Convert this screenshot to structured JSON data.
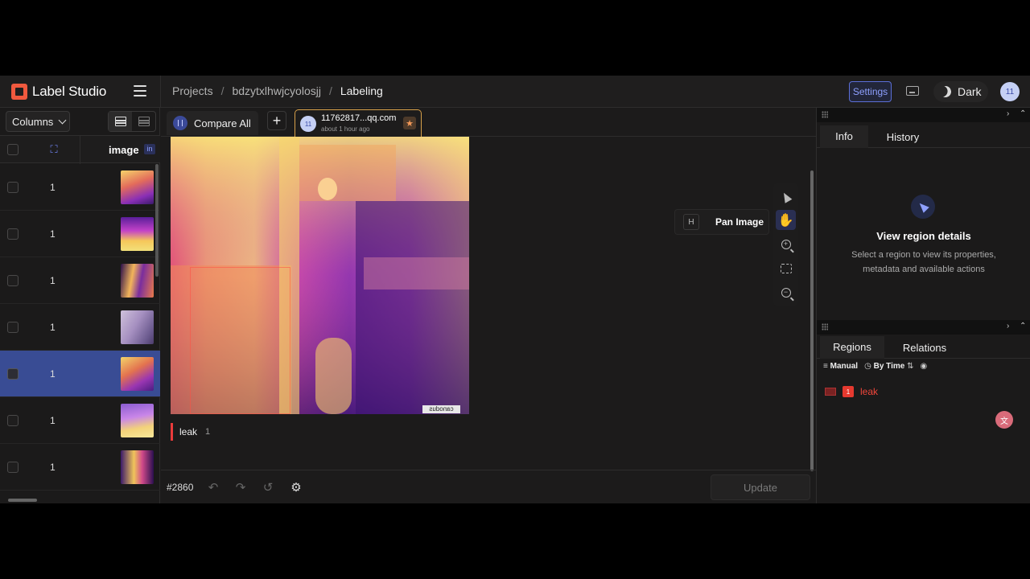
{
  "app": {
    "name": "Label Studio"
  },
  "breadcrumb": [
    "Projects",
    "bdzytxlhwjcyolosjj",
    "Labeling"
  ],
  "header": {
    "settings_label": "Settings",
    "theme_label": "Dark",
    "user_initials": "11"
  },
  "table": {
    "columns_label": "Columns",
    "image_header": "image",
    "badge": "in",
    "rows": [
      {
        "value": "1",
        "selected": false
      },
      {
        "value": "1",
        "selected": false
      },
      {
        "value": "1",
        "selected": false
      },
      {
        "value": "1",
        "selected": false
      },
      {
        "value": "1",
        "selected": true
      },
      {
        "value": "1",
        "selected": false
      },
      {
        "value": "1",
        "selected": false
      }
    ]
  },
  "tabs": {
    "compare_all": "Compare All",
    "annotation": {
      "avatar": "11",
      "title": "11762817...qq.com",
      "subtitle": "about 1 hour ago"
    }
  },
  "canvas": {
    "tooltip": {
      "key": "H",
      "label": "Pan Image"
    },
    "region_label": "leak",
    "region_count": "1"
  },
  "bottom": {
    "task_id": "#2860",
    "update_label": "Update"
  },
  "info_panel": {
    "tab_info": "Info",
    "tab_history": "History",
    "empty_title": "View region details",
    "empty_desc": "Select a region to view its properties, metadata and available actions"
  },
  "regions_panel": {
    "tab_regions": "Regions",
    "tab_relations": "Relations",
    "sort_manual": "Manual",
    "sort_time": "By Time",
    "region": {
      "index": "1",
      "label": "leak"
    }
  },
  "colors": {
    "accent": "#5b6fd8",
    "selected_row": "#394c94",
    "label_red": "#ea3b3b"
  }
}
